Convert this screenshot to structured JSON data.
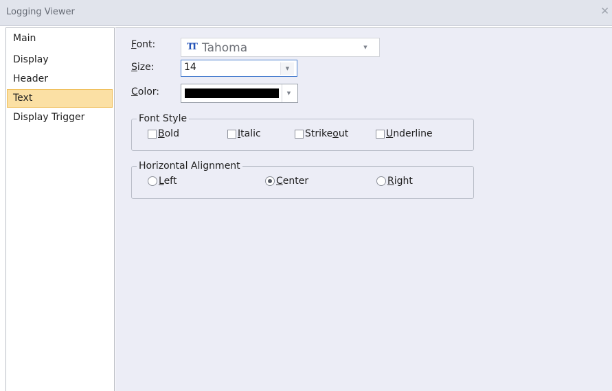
{
  "window": {
    "title": "Logging Viewer",
    "close_glyph": "✕"
  },
  "sidebar": {
    "items": [
      {
        "label": "Main",
        "active": false
      },
      {
        "label": "Display",
        "active": false
      },
      {
        "label": "Header",
        "active": false
      },
      {
        "label": "Text",
        "active": true
      },
      {
        "label": "Display Trigger",
        "active": false
      }
    ]
  },
  "text_settings": {
    "font": {
      "prefix": "",
      "hotkey": "F",
      "rest": "ont:",
      "value": "Tahoma",
      "icon": "truetype-font-icon"
    },
    "size": {
      "prefix": "",
      "hotkey": "S",
      "rest": "ize:",
      "value": "14"
    },
    "color": {
      "prefix": "",
      "hotkey": "C",
      "rest": "olor:",
      "value": "#000000"
    },
    "font_style": {
      "title": "Font Style",
      "options": [
        {
          "prefix": "",
          "hotkey": "B",
          "rest": "old",
          "checked": false
        },
        {
          "prefix": "",
          "hotkey": "I",
          "rest": "talic",
          "checked": false
        },
        {
          "prefix": "Strike",
          "hotkey": "o",
          "rest": "ut",
          "checked": false
        },
        {
          "prefix": "",
          "hotkey": "U",
          "rest": "nderline",
          "checked": false
        }
      ]
    },
    "horizontal_alignment": {
      "title": "Horizontal Alignment",
      "selected": "Center",
      "options": [
        {
          "prefix": "",
          "hotkey": "L",
          "rest": "eft",
          "selected": false
        },
        {
          "prefix": "",
          "hotkey": "C",
          "rest": "enter",
          "selected": true
        },
        {
          "prefix": "",
          "hotkey": "R",
          "rest": "ight",
          "selected": false
        }
      ]
    }
  },
  "colors": {
    "active_item_bg": "#fbe0a4",
    "active_item_border": "#f0bf5c",
    "panel_bg": "#ecedf6",
    "focus_border": "#4a7fcf"
  }
}
